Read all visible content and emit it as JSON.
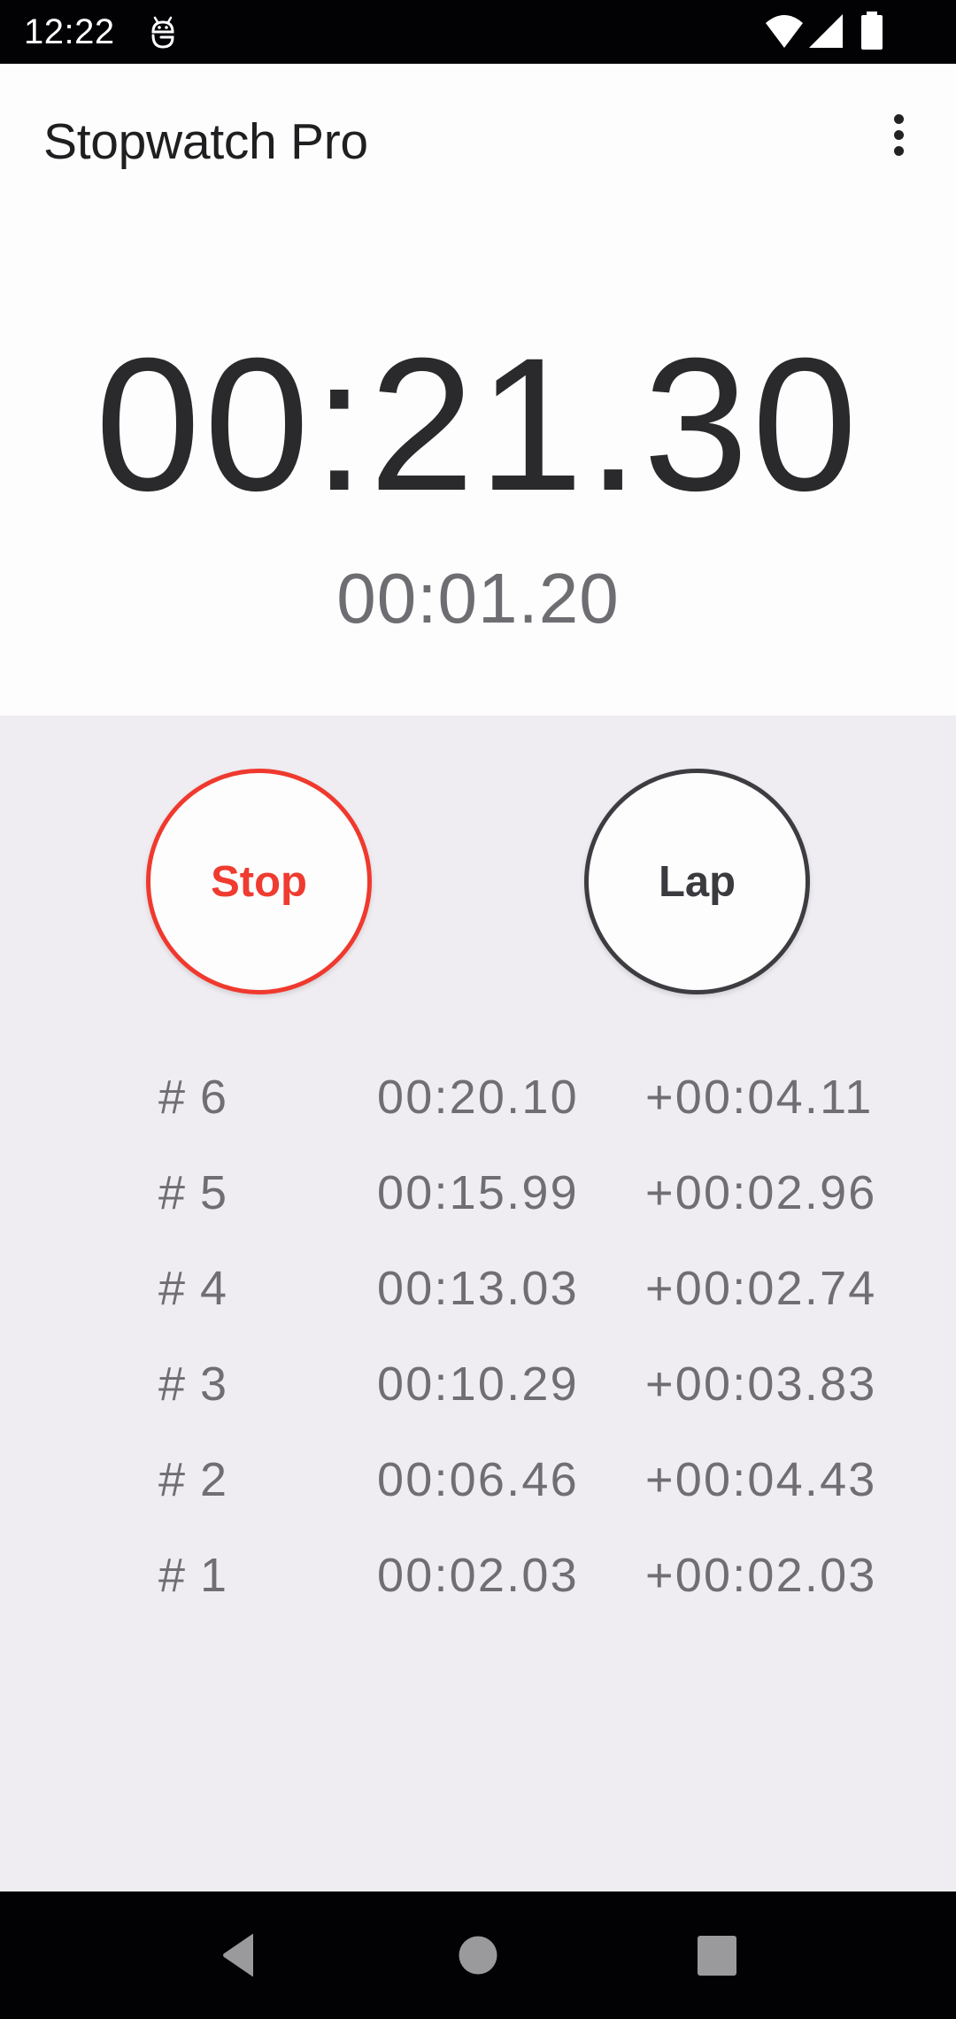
{
  "status_bar": {
    "time": "12:22",
    "icons": [
      "notification-robot-icon",
      "wifi-icon",
      "cellular-signal-icon",
      "battery-icon"
    ]
  },
  "app_bar": {
    "title": "Stopwatch Pro",
    "menu_icon": "more-vert-icon"
  },
  "timer": {
    "main": "00:21.30",
    "current_lap": "00:01.20"
  },
  "controls": {
    "stop_label": "Stop",
    "lap_label": "Lap",
    "stop_color": "#f0392e",
    "lap_color": "#3d3c40"
  },
  "laps": [
    {
      "number": "# 6",
      "total": "00:20.10",
      "diff": "+00:04.11"
    },
    {
      "number": "# 5",
      "total": "00:15.99",
      "diff": "+00:02.96"
    },
    {
      "number": "# 4",
      "total": "00:13.03",
      "diff": "+00:02.74"
    },
    {
      "number": "# 3",
      "total": "00:10.29",
      "diff": "+00:03.83"
    },
    {
      "number": "# 2",
      "total": "00:06.46",
      "diff": "+00:04.43"
    },
    {
      "number": "# 1",
      "total": "00:02.03",
      "diff": "+00:02.03"
    }
  ],
  "nav_bar": {
    "buttons": [
      "back-icon",
      "home-icon",
      "recents-icon"
    ]
  }
}
